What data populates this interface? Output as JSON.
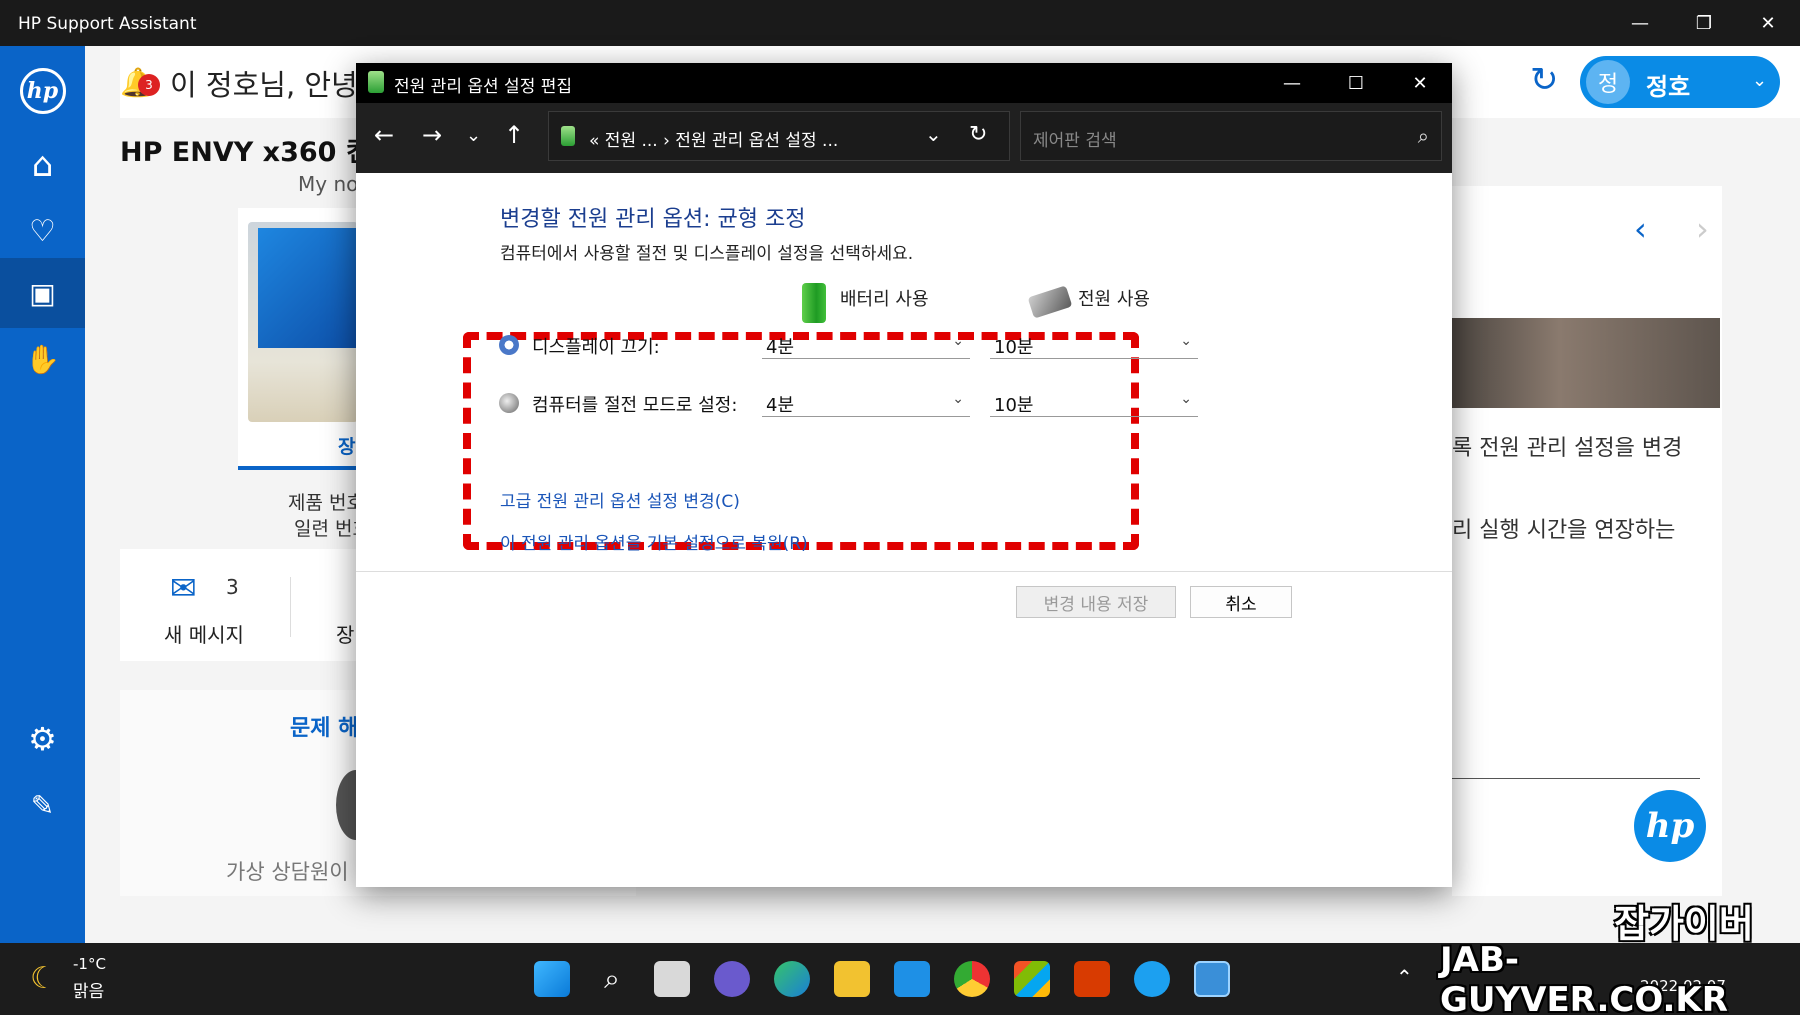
{
  "hp_app": {
    "title": "HP Support Assistant",
    "greeting": "이 정호님, 안녕",
    "notification_count": "3",
    "user_initial": "정",
    "user_name": "정호",
    "product_title": "HP ENVY x360 컨버터",
    "my_notebook": "My not",
    "tab_label": "장",
    "product_number_label": "제품 번호",
    "serial_number_label": "일련 번호",
    "messages_count": "3",
    "messages_label": "새 메시지",
    "second_card_label": "장",
    "problem_title": "문제 해",
    "virtual_agent": "가상 상담원이",
    "right_text_1": "록 전원 관리 설정을 변경",
    "right_text_2": "리 실행 시간을 연장하는"
  },
  "power_window": {
    "title": "전원 관리 옵션 설정 편집",
    "breadcrumb": "« 전원 ... › 전원 관리 옵션 설정 ...",
    "search_placeholder": "제어판 검색",
    "heading": "변경할 전원 관리 옵션: 균형 조정",
    "subtext": "컴퓨터에서 사용할 절전 및 디스플레이 설정을 선택하세요.",
    "battery_label": "배터리 사용",
    "plugged_label": "전원 사용",
    "rows": [
      {
        "label": "디스플레이 끄기:",
        "battery": "4분",
        "plugged": "10분"
      },
      {
        "label": "컴퓨터를 절전 모드로 설정:",
        "battery": "4분",
        "plugged": "10분"
      }
    ],
    "link_advanced": "고급 전원 관리 옵션 설정 변경(C)",
    "link_restore": "이 전원 관리 옵션을 기본 설정으로 복원(R)",
    "save_button": "변경 내용 저장",
    "cancel_button": "취소"
  },
  "taskbar": {
    "temperature": "-1°C",
    "weather": "맑음",
    "date": "2022 02 07"
  },
  "watermark": {
    "line1": "잡가이버",
    "line2": "JAB-GUYVER.CO.KR"
  },
  "colors": {
    "hp_blue": "#0a64c8",
    "highlight_red": "#e00000",
    "link_blue": "#1a55b8"
  }
}
